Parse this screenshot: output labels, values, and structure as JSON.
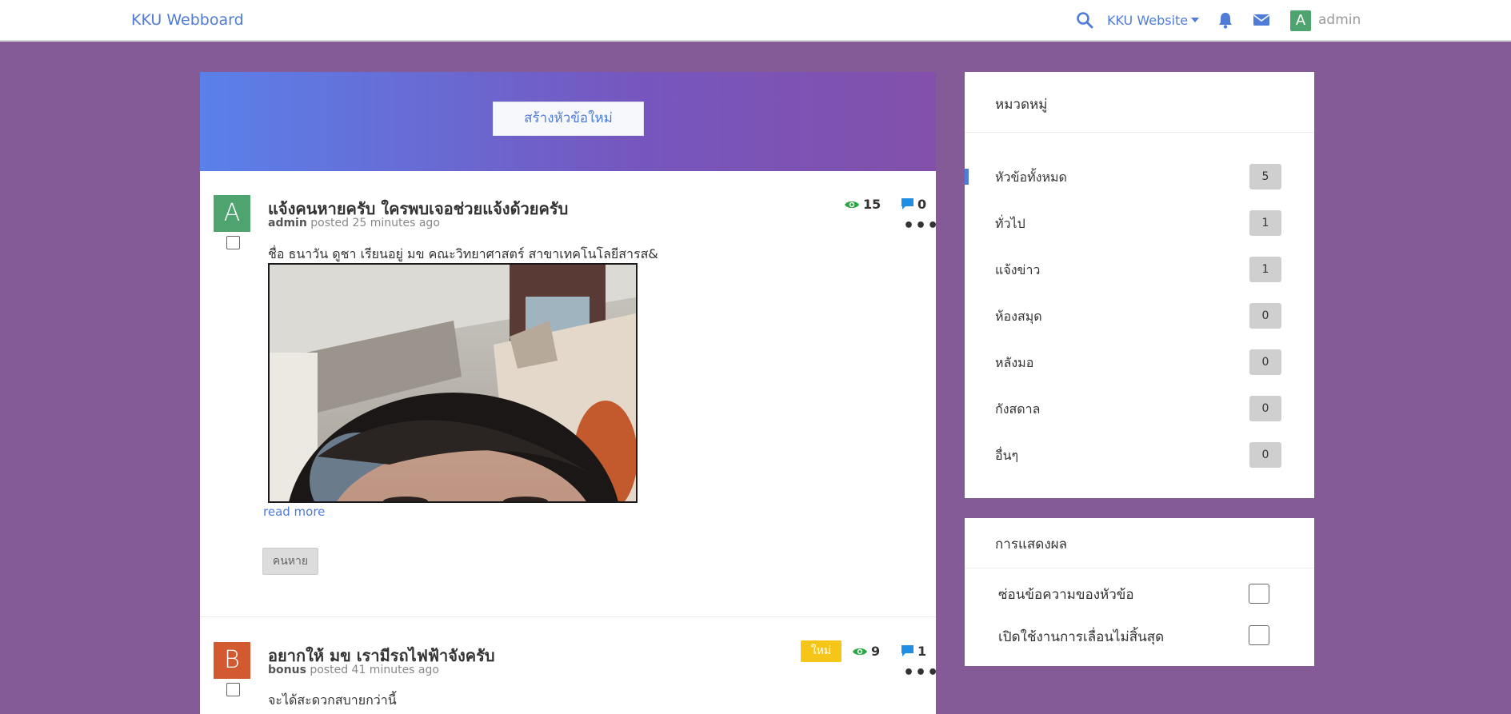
{
  "navbar": {
    "brand": "KKU Webboard",
    "site_link": "KKU Website",
    "user_initial": "A",
    "user_name": "admin",
    "icons": [
      "search-icon",
      "bell-icon",
      "mail-icon"
    ]
  },
  "main": {
    "new_topic_label": "สร้างหัวข้อใหม่",
    "topics": [
      {
        "avatar_initial": "A",
        "avatar_color": "#4fa36f",
        "title": "แจ้งคนหายครับ ใครพบเจอช่วยแจ้งด้วยครับ",
        "author": "admin",
        "posted": "posted 25 minutes ago",
        "excerpt": "ชื่อ ธนาวัน ดูชา เรียนอยู่ มข คณะวิทยาศาสตร์ สาขาเทคโนโลยีสารส&",
        "views": "15",
        "replies": "0",
        "read_more": "read more",
        "tag": "คนหาย"
      },
      {
        "avatar_initial": "B",
        "avatar_color": "#d35a30",
        "title": "อยากให้ มข เรามีรถไฟฟ้าจังครับ",
        "author": "bonus",
        "posted": "posted 41 minutes ago",
        "excerpt": "จะได้สะดวกสบายกว่านี้",
        "badge": "ใหม่",
        "views": "9",
        "replies": "1"
      }
    ]
  },
  "sidebar": {
    "categories_title": "หมวดหมู่",
    "categories": [
      {
        "label": "หัวข้อทั้งหมด",
        "count": "5",
        "active": true
      },
      {
        "label": "ทั่วไป",
        "count": "1"
      },
      {
        "label": "แจ้งข่าว",
        "count": "1"
      },
      {
        "label": "ห้องสมุด",
        "count": "0"
      },
      {
        "label": "หลังมอ",
        "count": "0"
      },
      {
        "label": "กังสดาล",
        "count": "0"
      },
      {
        "label": "อื่นๆ",
        "count": "0"
      }
    ],
    "display_title": "การแสดงผล",
    "options": [
      {
        "label": "ซ่อนข้อความของหัวข้อ",
        "checked": false
      },
      {
        "label": "เปิดใช้งานการเลื่อนไม่สิ้นสุด",
        "checked": false
      }
    ]
  },
  "colors": {
    "background": "#845b96",
    "accent": "#4f7cd6",
    "views_icon": "#27a845",
    "replies_icon": "#1f8fe6",
    "new_badge": "#f5c518"
  }
}
